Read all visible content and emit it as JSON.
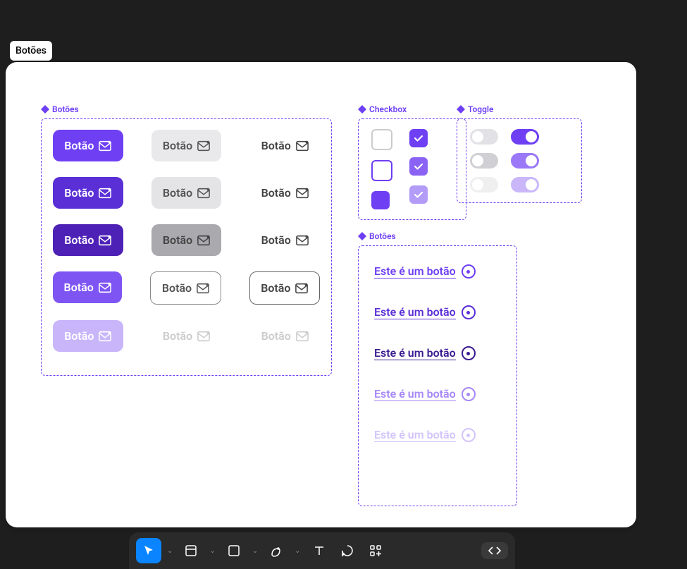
{
  "frame_name": "Botões",
  "sections": {
    "buttons": {
      "title": "Botões",
      "label": "Botão"
    },
    "checkbox": {
      "title": "Checkbox"
    },
    "toggle": {
      "title": "Toggle"
    },
    "link_buttons": {
      "title": "Botões",
      "label": "Este é um botão"
    }
  },
  "colors": {
    "accent": "#6E3FF3"
  },
  "toolbar": {
    "tools": [
      "move",
      "frame",
      "rect",
      "pen",
      "text",
      "comment",
      "actions",
      "dev-mode"
    ]
  }
}
